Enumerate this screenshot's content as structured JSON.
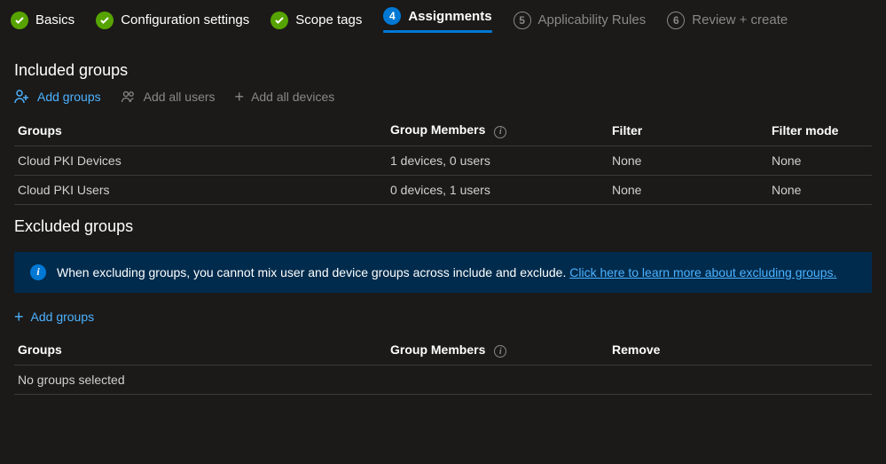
{
  "wizard": {
    "steps": [
      {
        "num": "1",
        "label": "Basics",
        "state": "complete"
      },
      {
        "num": "2",
        "label": "Configuration settings",
        "state": "complete"
      },
      {
        "num": "3",
        "label": "Scope tags",
        "state": "complete"
      },
      {
        "num": "4",
        "label": "Assignments",
        "state": "active"
      },
      {
        "num": "5",
        "label": "Applicability Rules",
        "state": "pending"
      },
      {
        "num": "6",
        "label": "Review + create",
        "state": "pending"
      }
    ]
  },
  "included": {
    "heading": "Included groups",
    "toolbar": {
      "add_groups": "Add groups",
      "add_all_users": "Add all users",
      "add_all_devices": "Add all devices"
    },
    "columns": {
      "groups": "Groups",
      "members": "Group Members",
      "filter": "Filter",
      "filter_mode": "Filter mode"
    },
    "rows": [
      {
        "group": "Cloud PKI Devices",
        "members": "1 devices, 0 users",
        "filter": "None",
        "filter_mode": "None"
      },
      {
        "group": "Cloud PKI Users",
        "members": "0 devices, 1 users",
        "filter": "None",
        "filter_mode": "None"
      }
    ]
  },
  "excluded": {
    "heading": "Excluded groups",
    "banner_text": "When excluding groups, you cannot mix user and device groups across include and exclude. ",
    "banner_link": "Click here to learn more about excluding groups.",
    "toolbar": {
      "add_groups": "Add groups"
    },
    "columns": {
      "groups": "Groups",
      "members": "Group Members",
      "remove": "Remove"
    },
    "empty": "No groups selected"
  }
}
